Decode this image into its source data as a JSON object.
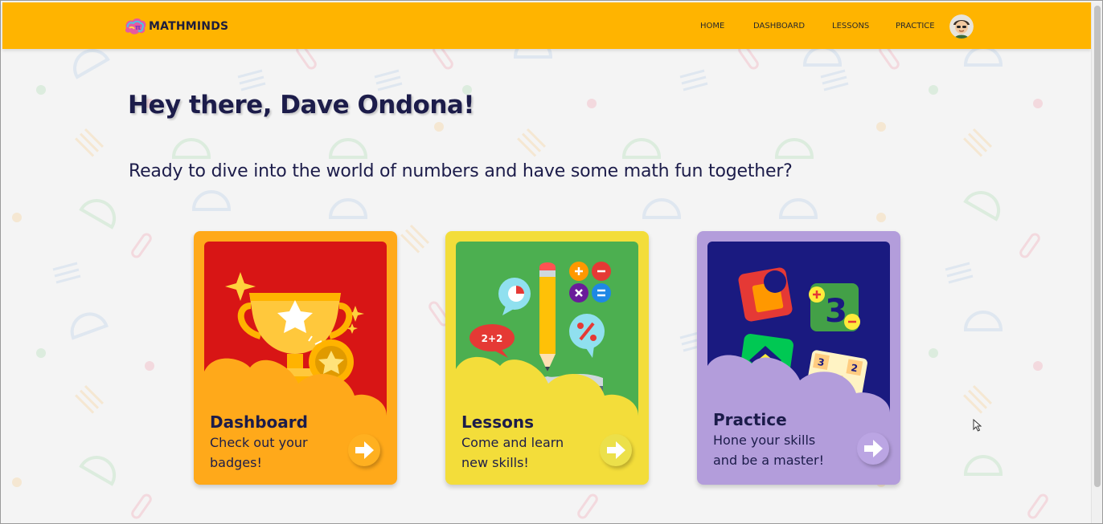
{
  "brand": {
    "name": "MATHMINDS"
  },
  "nav": {
    "home": "HOME",
    "dashboard": "DASHBOARD",
    "lessons": "LESSONS",
    "practice": "PRACTICE"
  },
  "hero": {
    "greeting": "Hey there, Dave Ondona!",
    "subtitle": "Ready to dive into the world of numbers and have some math fun together?"
  },
  "cards": {
    "dashboard": {
      "title": "Dashboard",
      "desc": "Check out your badges!"
    },
    "lessons": {
      "title": "Lessons",
      "desc": "Come and learn new skills!"
    },
    "practice": {
      "title": "Practice",
      "desc": "Hone your skills and be a master!"
    }
  },
  "art": {
    "lessons_bubble": "2+2"
  },
  "colors": {
    "header": "#ffb400",
    "text_dark": "#1c1c4a",
    "dashboard_card": "#ffa91a",
    "dashboard_art": "#d81515",
    "lessons_card": "#f3dd3a",
    "lessons_art": "#4caf50",
    "practice_card": "#b39ddb",
    "practice_art": "#1a1a80"
  },
  "icons": {
    "logo": "brain-logo-icon",
    "avatar": "user-avatar",
    "arrow": "arrow-right-icon"
  }
}
